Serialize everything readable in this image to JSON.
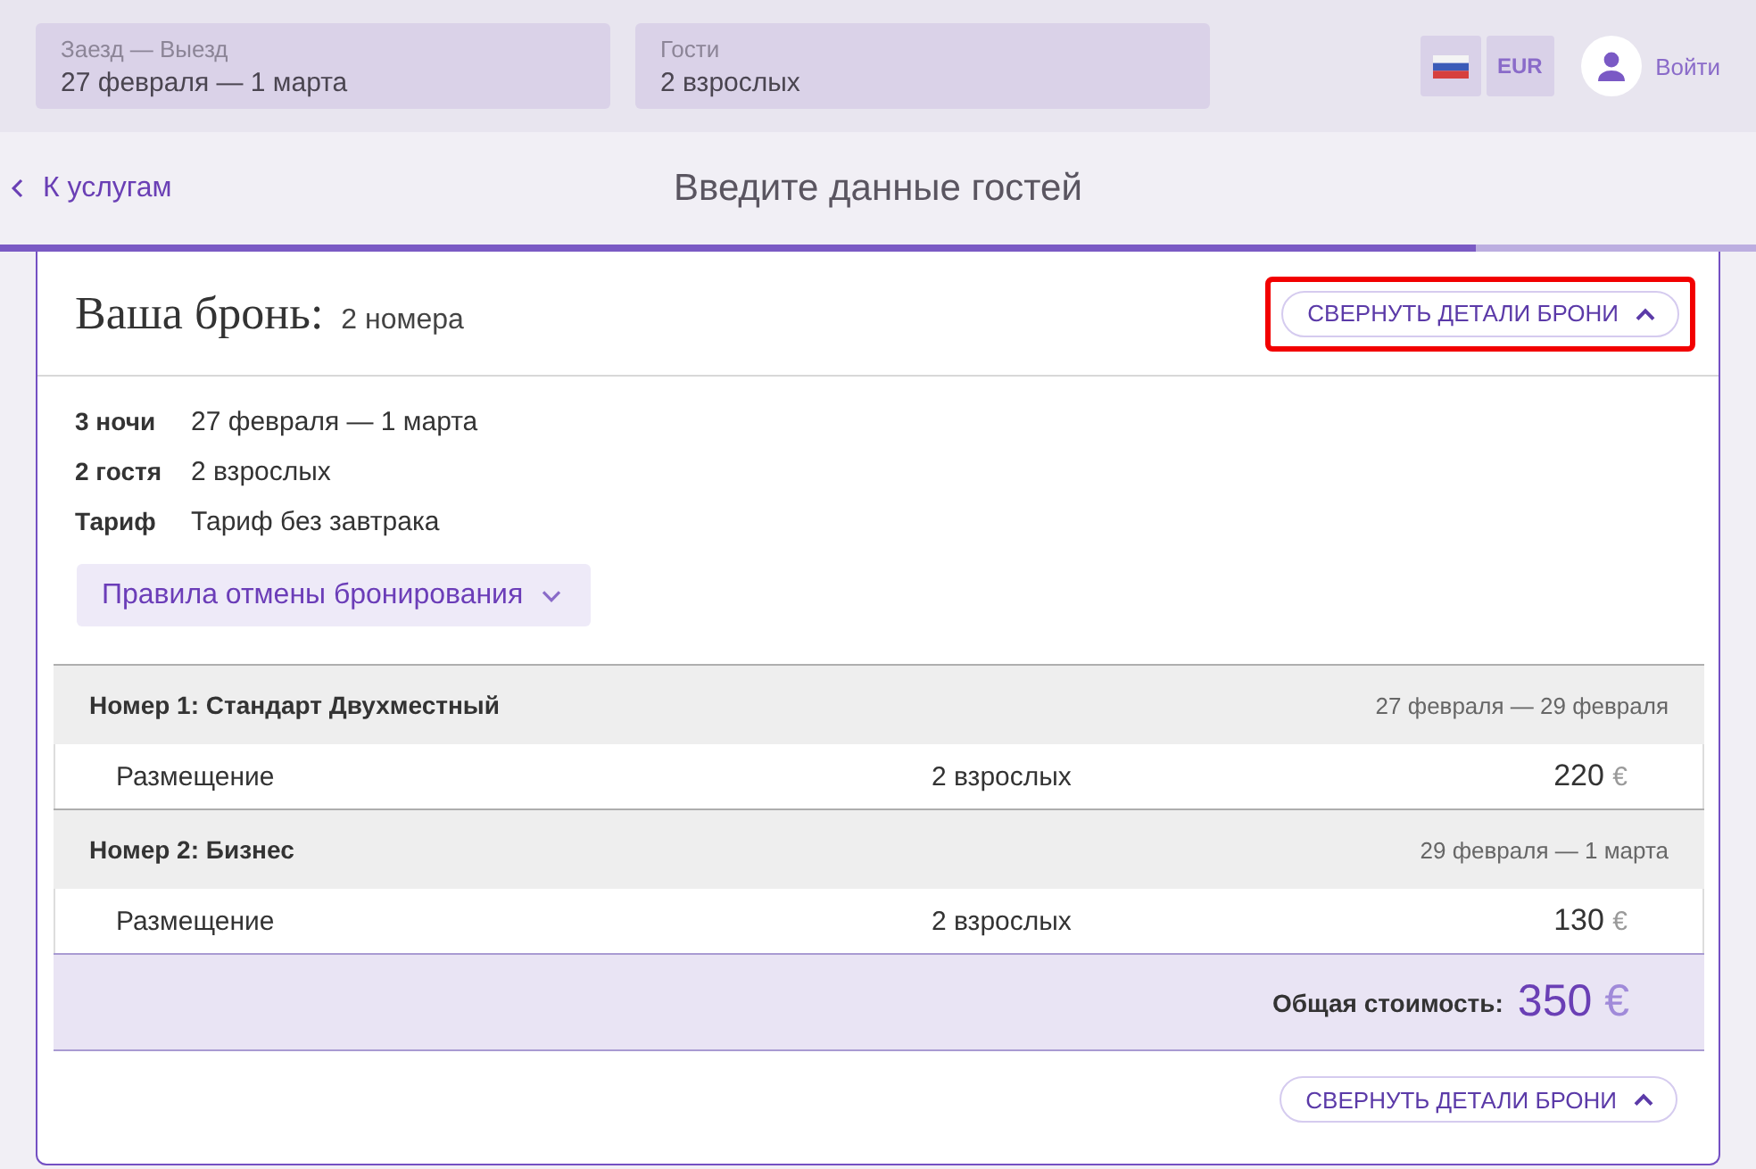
{
  "header": {
    "fields": [
      {
        "label": "Заезд — Выезд",
        "value": "27 февраля — 1 марта"
      },
      {
        "label": "Гости",
        "value": "2 взрослых"
      }
    ],
    "currency": "EUR",
    "login": "Войти"
  },
  "nav": {
    "back": "К услугам",
    "title": "Введите данные гостей"
  },
  "progress": {
    "level": 0.84
  },
  "booking": {
    "title": "Ваша бронь:",
    "rooms_count": "2 номера",
    "collapse_button": {
      "label": "СВЕРНУТЬ ДЕТАЛИ БРОНИ",
      "highlighted": true
    },
    "details": [
      {
        "label": "3 ночи",
        "value": "27 февраля — 1 марта"
      },
      {
        "label": "2 гостя",
        "value": "2 взрослых"
      },
      {
        "label": "Тариф",
        "value": "Тариф без завтрака"
      }
    ],
    "cancellation_button": {
      "label": "Правила отмены бронирования",
      "expanded": false
    },
    "rooms": [
      {
        "title": "Номер 1: Стандарт Двухместный",
        "dates": "27 февраля — 29 февраля",
        "lines": [
          {
            "name": "Размещение",
            "guests": "2 взрослых",
            "price": "220",
            "currency": "€"
          }
        ]
      },
      {
        "title": "Номер 2: Бизнес",
        "dates": "29 февраля — 1 марта",
        "lines": [
          {
            "name": "Размещение",
            "guests": "2 взрослых",
            "price": "130",
            "currency": "€"
          }
        ]
      }
    ],
    "total": {
      "label": "Общая стоимость:",
      "amount": "350",
      "currency": "€"
    },
    "footer_collapse_button": {
      "label": "СВЕРНУТЬ ДЕТАЛИ БРОНИ",
      "highlighted": false
    }
  }
}
